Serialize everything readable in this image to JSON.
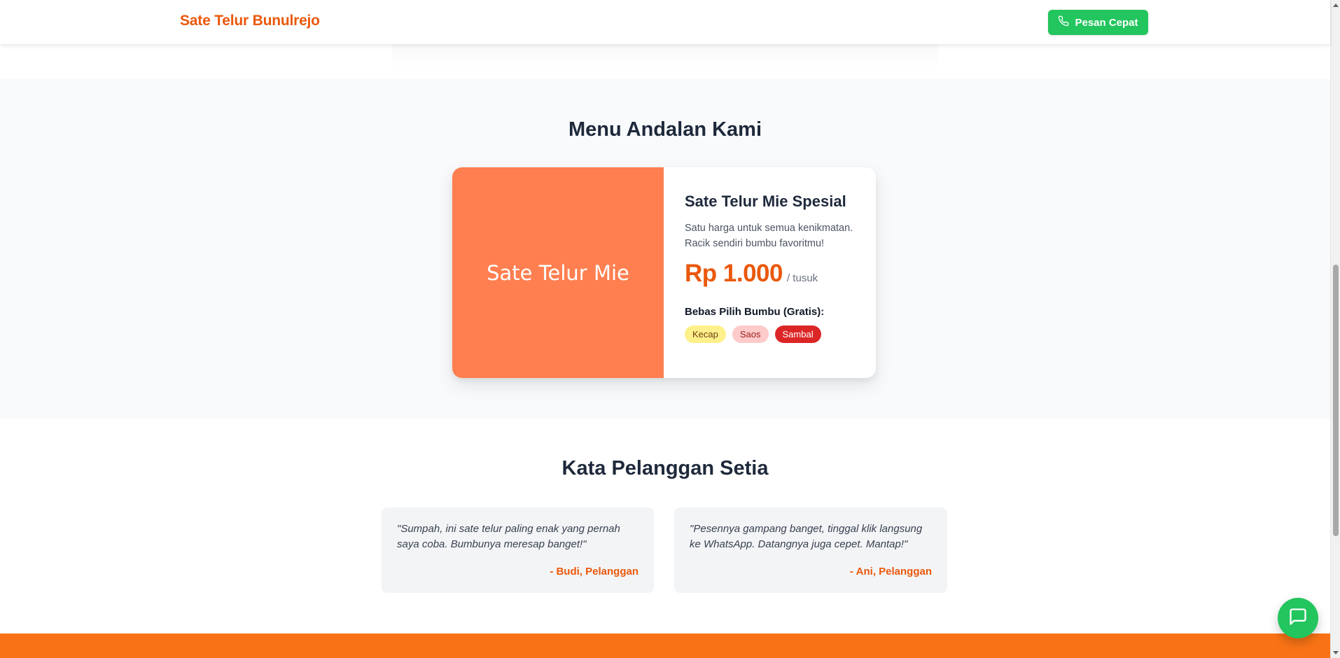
{
  "navbar": {
    "brand": "Sate Telur Bunulrejo",
    "quick_order_label": "Pesan Cepat",
    "quick_order_icon": "phone-icon"
  },
  "menu": {
    "title": "Menu Andalan Kami",
    "item": {
      "image_label": "Sate Telur Mie",
      "image_color": "#ff7f50",
      "name": "Sate Telur Mie Spesial",
      "description": "Satu harga untuk semua kenikmatan. Racik sendiri bumbu favoritmu!",
      "price": "Rp 1.000",
      "price_unit": "/ tusuk",
      "sauce_title": "Bebas Pilih Bumbu (Gratis):",
      "sauces": [
        "Kecap",
        "Saos",
        "Sambal"
      ]
    }
  },
  "testimonials": {
    "title": "Kata Pelanggan Setia",
    "items": [
      {
        "quote": "\"Sumpah, ini sate telur paling enak yang pernah saya coba. Bumbunya meresap banget!\"",
        "author": "- Budi, Pelanggan"
      },
      {
        "quote": "\"Pesennya gampang banget, tinggal klik langsung ke WhatsApp. Datangnya juga cepet. Mantap!\"",
        "author": "- Ani, Pelanggan"
      }
    ]
  },
  "chat_button": {
    "icon": "chat-icon"
  },
  "colors": {
    "brand": "#ea580c",
    "whatsapp_green": "#22c55e",
    "footer": "#f97316"
  }
}
